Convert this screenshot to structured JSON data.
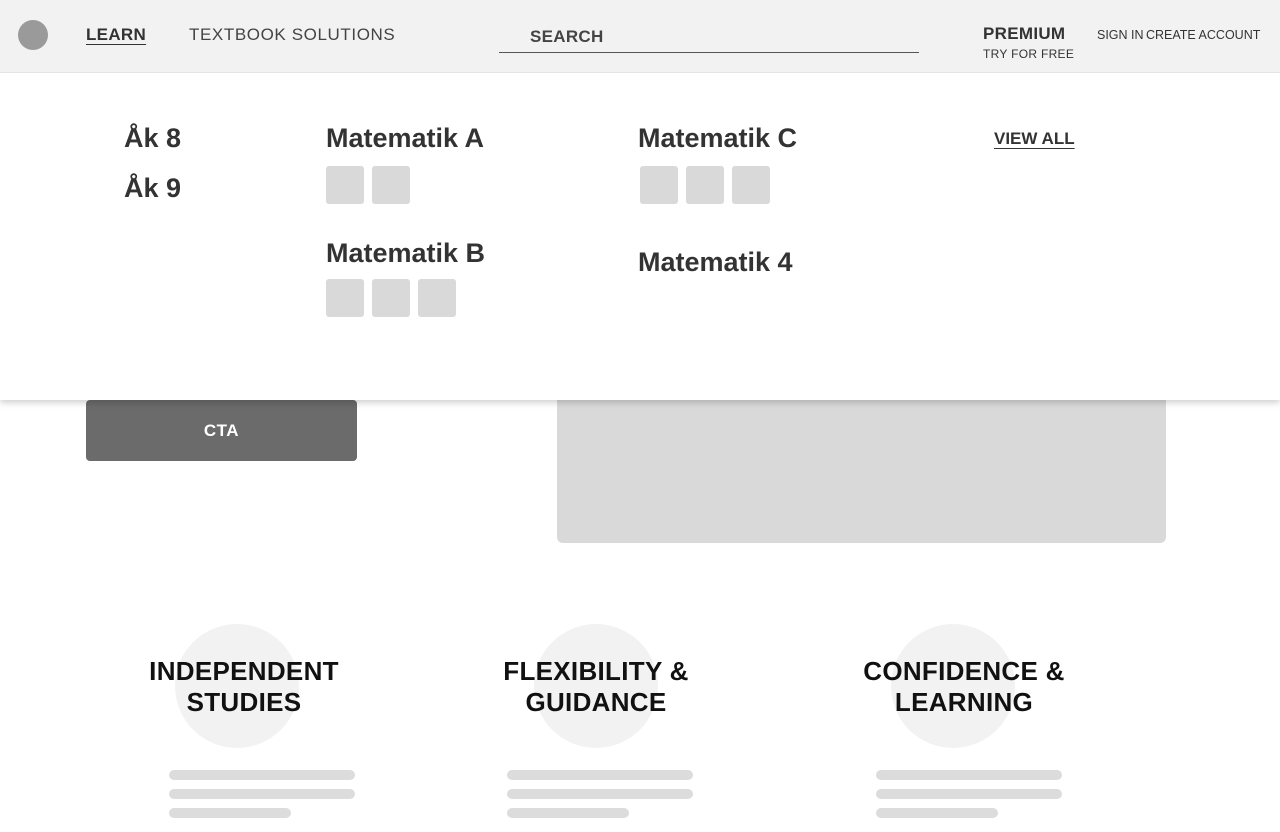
{
  "header": {
    "nav": {
      "learn": "LEARN",
      "textbook_solutions": "TEXTBOOK SOLUTIONS"
    },
    "search_placeholder": "SEARCH",
    "premium": {
      "title": "PREMIUM",
      "subtitle": "TRY FOR FREE"
    },
    "auth": {
      "sign_in": "SIGN IN",
      "create_account": "CREATE ACCOUNT"
    }
  },
  "mega_menu": {
    "grades": [
      "Åk 8",
      "Åk 9"
    ],
    "courses": {
      "a": {
        "title": "Matematik A",
        "chip_count": 2
      },
      "b": {
        "title": "Matematik B",
        "chip_count": 3
      },
      "c": {
        "title": "Matematik C",
        "chip_count": 3
      },
      "d": {
        "title": "Matematik 4",
        "chip_count": 0
      }
    },
    "view_all": "VIEW ALL"
  },
  "hero": {
    "cta_label": "CTA"
  },
  "features": [
    {
      "line1": "INDEPENDENT",
      "line2": "STUDIES"
    },
    {
      "line1": "FLEXIBILITY &",
      "line2": "GUIDANCE"
    },
    {
      "line1": "CONFIDENCE &",
      "line2": "LEARNING"
    }
  ],
  "colors": {
    "header_bg": "#f2f2f2",
    "cta_bg": "#6b6b6b",
    "placeholder_gray": "#d9d9d9",
    "logo": "#9a9a9a"
  }
}
